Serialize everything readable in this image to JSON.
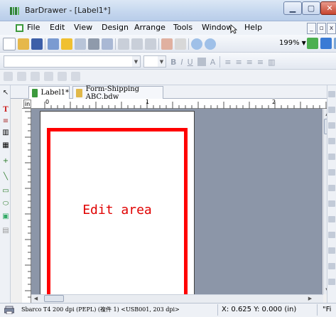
{
  "window": {
    "title": "BarDrawer - [Label1*]"
  },
  "menu": [
    "File",
    "Edit",
    "View",
    "Design",
    "Arrange",
    "Tools",
    "Window",
    "Help"
  ],
  "toolbar": {
    "zoom": "199%"
  },
  "tabs": [
    {
      "label": "Label1*"
    },
    {
      "label": "Form-Shipping ABC.bdw"
    }
  ],
  "ruler": {
    "unit": "in",
    "marks": [
      "0",
      "1",
      "2"
    ]
  },
  "canvas": {
    "annotation": "Edit area"
  },
  "status": {
    "printer": "Sbarco T4 200 dpi (PEPL) (複件 1) <USB001, 203 dpi>",
    "coordinates": "X: 0.625  Y: 0.000 (in)",
    "font": "\"Fi"
  },
  "colors": {
    "annotation": "#ff0000",
    "canvas_bg": "#8c96a8",
    "titlebar": "#c4d6ee"
  }
}
